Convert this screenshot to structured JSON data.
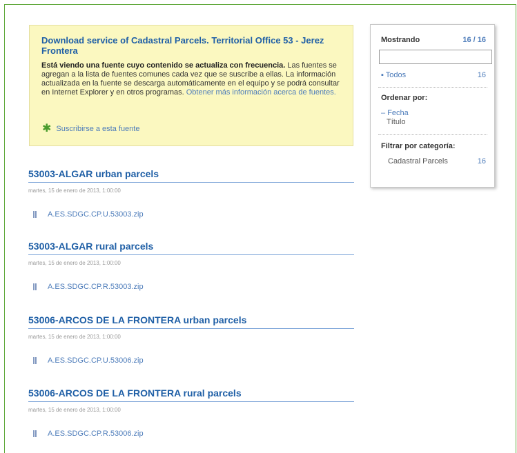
{
  "feed": {
    "title": "Download service of Cadastral Parcels. Territorial Office 53 - Jerez Frontera",
    "desc_bold": "Está viendo una fuente cuyo contenido se actualiza con frecuencia.",
    "desc_text": " Las fuentes se agregan a la lista de fuentes comunes cada vez que se suscribe a ellas. La información actualizada en la fuente se descarga automáticamente en el equipo y se podrá consultar en Internet Explorer y en otros programas.",
    "learn_more": "Obtener más información acerca de fuentes.",
    "subscribe": "Suscribirse a esta fuente"
  },
  "entries": [
    {
      "title": "53003-ALGAR urban parcels",
      "date": "martes, 15 de enero de 2013, 1:00:00",
      "attachment": "A.ES.SDGC.CP.U.53003.zip"
    },
    {
      "title": "53003-ALGAR rural parcels",
      "date": "martes, 15 de enero de 2013, 1:00:00",
      "attachment": "A.ES.SDGC.CP.R.53003.zip"
    },
    {
      "title": "53006-ARCOS DE LA FRONTERA urban parcels",
      "date": "martes, 15 de enero de 2013, 1:00:00",
      "attachment": "A.ES.SDGC.CP.U.53006.zip"
    },
    {
      "title": "53006-ARCOS DE LA FRONTERA rural parcels",
      "date": "martes, 15 de enero de 2013, 1:00:00",
      "attachment": "A.ES.SDGC.CP.R.53006.zip"
    }
  ],
  "panel": {
    "showing_label": "Mostrando",
    "showing_count": "16 / 16",
    "search_value": "",
    "all_label": "Todos",
    "all_count": "16",
    "sort_label": "Ordenar por:",
    "sort_date": "Fecha",
    "sort_title": "Título",
    "filter_label": "Filtrar por categoría:",
    "category": "Cadastral Parcels",
    "category_count": "16"
  },
  "icons": {
    "subscribe": "star-plus-icon",
    "attachment": "paperclip-icon",
    "bullet": "bullet-icon",
    "selected_sort": "dash-marker-icon"
  }
}
